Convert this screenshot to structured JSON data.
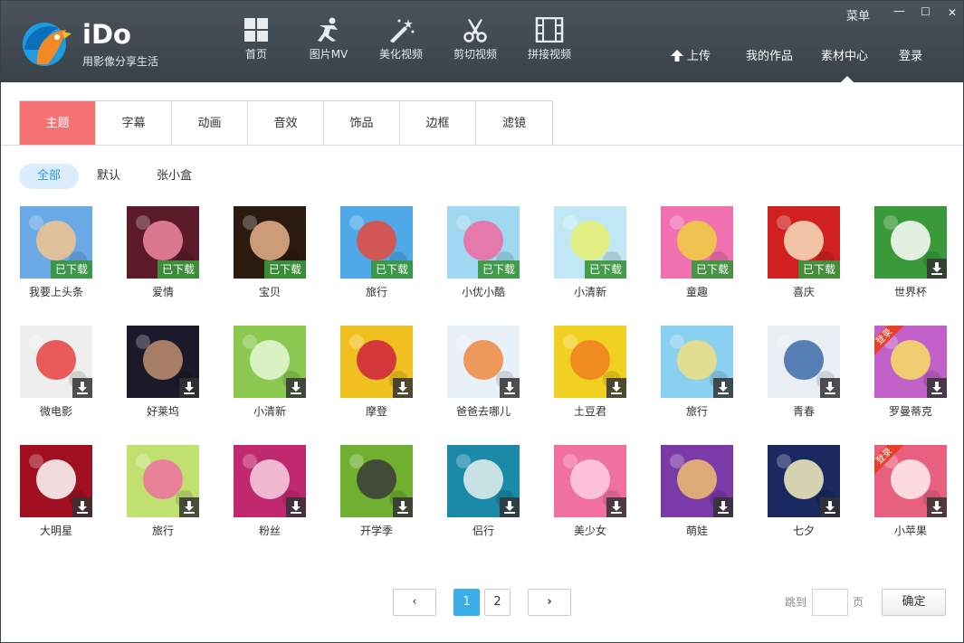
{
  "app": {
    "brand": "iDo",
    "slogan": "用影像分享生活"
  },
  "nav": [
    {
      "label": "首页",
      "icon": "home-icon"
    },
    {
      "label": "图片MV",
      "icon": "dancer-icon"
    },
    {
      "label": "美化视频",
      "icon": "magic-wand-icon"
    },
    {
      "label": "剪切视频",
      "icon": "scissors-icon"
    },
    {
      "label": "拼接视频",
      "icon": "film-icon"
    }
  ],
  "window": {
    "menu": "菜单",
    "minimize": "—",
    "maximize": "☐",
    "close": "✕"
  },
  "right_nav": {
    "upload": "上传",
    "my_works": "我的作品",
    "material_center": "素材中心",
    "login": "登录"
  },
  "tabs": [
    {
      "label": "主题",
      "active": true
    },
    {
      "label": "字幕",
      "active": false
    },
    {
      "label": "动画",
      "active": false
    },
    {
      "label": "音效",
      "active": false
    },
    {
      "label": "饰品",
      "active": false
    },
    {
      "label": "边框",
      "active": false
    },
    {
      "label": "滤镜",
      "active": false
    }
  ],
  "filters": [
    {
      "label": "全部",
      "active": true
    },
    {
      "label": "默认",
      "active": false
    },
    {
      "label": "张小盒",
      "active": false
    }
  ],
  "downloaded_label": "已下载",
  "items": [
    {
      "label": "我要上头条",
      "downloaded": true,
      "bg": "#6aa9e6",
      "accent": "#f2c48c"
    },
    {
      "label": "爱情",
      "downloaded": true,
      "bg": "#5a1a2a",
      "accent": "#f08aa0"
    },
    {
      "label": "宝贝",
      "downloaded": true,
      "bg": "#2a1a10",
      "accent": "#e8b48a"
    },
    {
      "label": "旅行",
      "downloaded": true,
      "bg": "#4fa8e8",
      "accent": "#e84a3a"
    },
    {
      "label": "小优小酷",
      "downloaded": true,
      "bg": "#9fd8f0",
      "accent": "#f06aa0"
    },
    {
      "label": "小清新",
      "downloaded": true,
      "bg": "#bfe8f4",
      "accent": "#e8f070"
    },
    {
      "label": "童趣",
      "downloaded": true,
      "bg": "#f070b0",
      "accent": "#f0d040"
    },
    {
      "label": "喜庆",
      "downloaded": true,
      "bg": "#d02020",
      "accent": "#f8e0c0"
    },
    {
      "label": "世界杯",
      "downloaded": false,
      "bg": "#3a9a3a",
      "accent": "#ffffff"
    },
    {
      "label": "微电影",
      "downloaded": false,
      "bg": "#eeeeee",
      "accent": "#e84040"
    },
    {
      "label": "好莱坞",
      "downloaded": false,
      "bg": "#1a1a2a",
      "accent": "#c09070"
    },
    {
      "label": "小清新",
      "downloaded": false,
      "bg": "#8ac850",
      "accent": "#e8f8d8"
    },
    {
      "label": "摩登",
      "downloaded": false,
      "bg": "#f0c020",
      "accent": "#d02040"
    },
    {
      "label": "爸爸去哪儿",
      "downloaded": false,
      "bg": "#e8f0f8",
      "accent": "#f08840"
    },
    {
      "label": "土豆君",
      "downloaded": false,
      "bg": "#f0d020",
      "accent": "#f08020"
    },
    {
      "label": "旅行",
      "downloaded": false,
      "bg": "#8ad0f0",
      "accent": "#f0e080"
    },
    {
      "label": "青春",
      "downloaded": false,
      "bg": "#e8eef4",
      "accent": "#3a6aa8"
    },
    {
      "label": "罗曼蒂克",
      "downloaded": false,
      "bg": "#c060c8",
      "accent": "#f8e060",
      "corner": "登录"
    },
    {
      "label": "大明星",
      "downloaded": false,
      "bg": "#a01020",
      "accent": "#ffffff"
    },
    {
      "label": "旅行",
      "downloaded": false,
      "bg": "#c0e070",
      "accent": "#f070a0"
    },
    {
      "label": "粉丝",
      "downloaded": false,
      "bg": "#c02870",
      "accent": "#f8d0e0"
    },
    {
      "label": "开学季",
      "downloaded": false,
      "bg": "#70b030",
      "accent": "#3a3a3a"
    },
    {
      "label": "侣行",
      "downloaded": false,
      "bg": "#1a8aa8",
      "accent": "#e8f0f0"
    },
    {
      "label": "美少女",
      "downloaded": false,
      "bg": "#f070a0",
      "accent": "#ffd0e0"
    },
    {
      "label": "萌娃",
      "downloaded": false,
      "bg": "#7a3aa8",
      "accent": "#f0c070"
    },
    {
      "label": "七夕",
      "downloaded": false,
      "bg": "#1a2a60",
      "accent": "#f8f0c0"
    },
    {
      "label": "小苹果",
      "downloaded": false,
      "bg": "#e86080",
      "accent": "#fff0f0",
      "corner": "登录"
    }
  ],
  "pager": {
    "prev": "‹",
    "next": "›",
    "pages": [
      "1",
      "2"
    ],
    "current": "1",
    "jump_prefix": "跳到",
    "jump_suffix": "页",
    "confirm": "确定"
  },
  "colors": {
    "header_bg": "#434c54",
    "tab_active": "#f57274",
    "filter_active_bg": "#dceefd",
    "filter_active_text": "#2d9ae2",
    "page_current": "#3aaee8",
    "downloaded_badge": "#3a963c"
  }
}
